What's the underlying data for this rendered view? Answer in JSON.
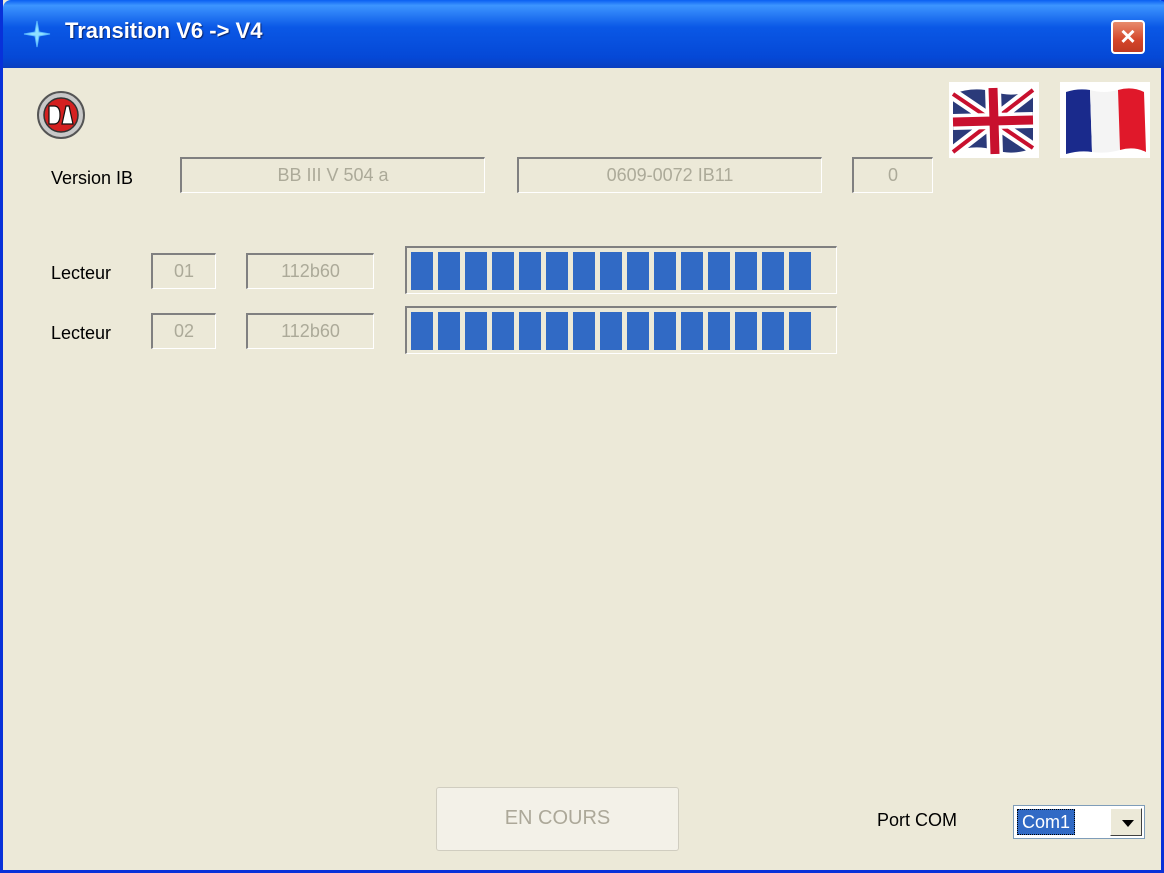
{
  "window": {
    "title": "Transition V6 -> V4",
    "close_label": "×"
  },
  "version": {
    "label": "Version IB",
    "field1": "BB III V 504 a",
    "field2": "0609-0072 IB11",
    "field3": "0"
  },
  "readers": [
    {
      "label": "Lecteur",
      "id": "01",
      "code": "112b60",
      "progress": 1.0
    },
    {
      "label": "Lecteur",
      "id": "02",
      "code": "112b60",
      "progress": 1.0
    }
  ],
  "action": {
    "button_label": "EN COURS"
  },
  "port": {
    "label": "Port COM",
    "selected": "Com1"
  },
  "icons": {
    "title": "sparkle-icon",
    "logo": "dag-logo",
    "lang_en": "uk-flag-icon",
    "lang_fr": "france-flag-icon"
  },
  "colors": {
    "titlebar": "#0a58e6",
    "progress": "#316ac5",
    "close": "#d4462a"
  }
}
